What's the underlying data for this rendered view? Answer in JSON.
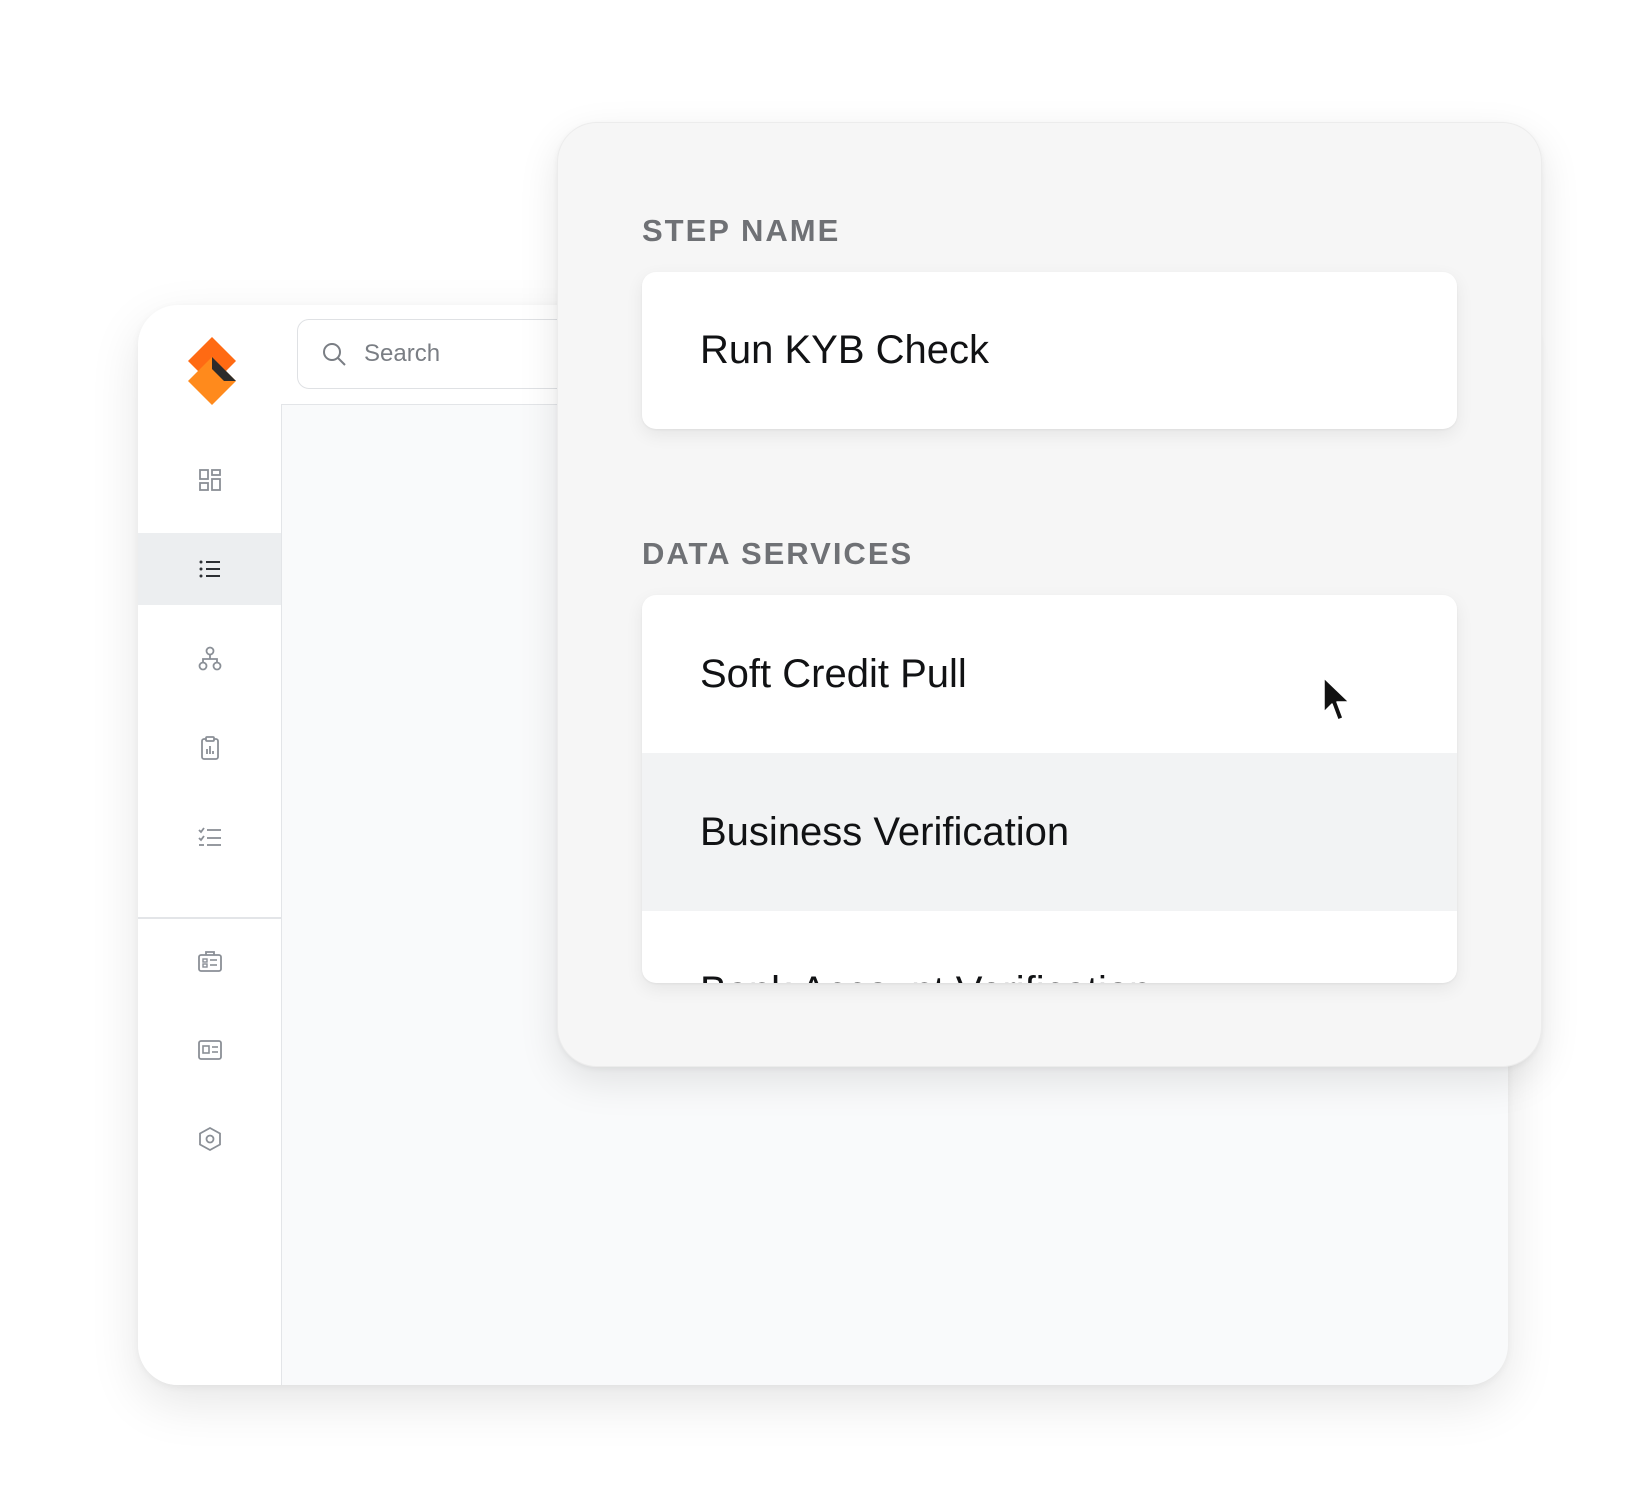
{
  "search": {
    "placeholder": "Search"
  },
  "sidebar": {
    "logo": "app-logo",
    "items": [
      {
        "icon": "dashboard-icon",
        "active": false
      },
      {
        "icon": "list-icon",
        "active": true
      },
      {
        "icon": "workflow-icon",
        "active": false
      },
      {
        "icon": "clipboard-chart-icon",
        "active": false
      },
      {
        "icon": "checklist-icon",
        "active": false
      },
      {
        "icon": "briefcase-icon",
        "active": false
      },
      {
        "icon": "id-card-icon",
        "active": false
      },
      {
        "icon": "settings-hexagon-icon",
        "active": false
      }
    ]
  },
  "panel": {
    "step_name_label": "STEP NAME",
    "step_name_value": "Run KYB Check",
    "data_services_label": "DATA SERVICES",
    "services": [
      {
        "label": "Soft Credit Pull"
      },
      {
        "label": "Business Verification",
        "highlighted": true
      },
      {
        "label": "Bank Account Verification"
      }
    ]
  },
  "colors": {
    "brand_orange": "#ff6a13",
    "brand_orange_light": "#ff8a1c",
    "highlight_row": "#f2f3f4",
    "active_nav": "#eceef0"
  }
}
